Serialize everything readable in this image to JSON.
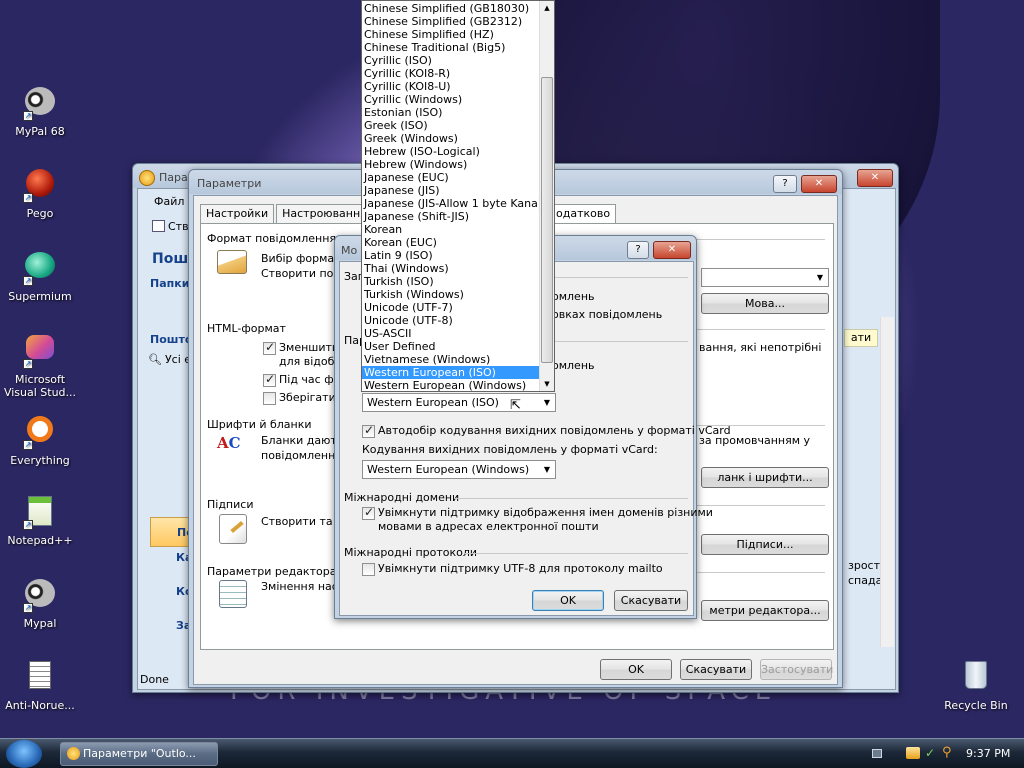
{
  "desktop": {
    "icons": [
      "MyPal 68",
      "Pego",
      "Supermium",
      "Microsoft Visual Stud...",
      "Everything",
      "Notepad++",
      "Mypal",
      "Anti-Norue...",
      "Recycle Bin"
    ],
    "wallpaper_text": "FOR INVESTIGATIVE OF SPACE"
  },
  "outlook": {
    "title": "Параме",
    "menu_file": "Файл",
    "status": "Done",
    "toolbar_item": "Ств",
    "nav": {
      "mail_header": "Пошт",
      "folders_label": "Папки у",
      "mail2": "Пошто",
      "all": "Усі е",
      "side_mail": "По",
      "side_cal": "Ка",
      "side_contacts": "Ко",
      "side_tasks": "За"
    },
    "right": {
      "btn": "ати",
      "text1": "зрост",
      "text2": "спада"
    }
  },
  "params": {
    "title": "Параметри",
    "tabs": [
      "Настройки",
      "Настроювання по",
      "одатково"
    ],
    "sections": {
      "format": "Формат повідомлення",
      "html": "HTML-формат",
      "fonts": "Шрифти й бланки",
      "sign": "Підписи",
      "editor": "Параметри редактора"
    },
    "format_text1": "Вибір формату",
    "format_text2": "Створити повід",
    "lang_btn": "Мова...",
    "html_c1": "Зменшити р",
    "html_c1b": "для відобра",
    "html_c2": "Під час фор",
    "html_c3": "Зберігати см",
    "html_right": "вання, які непотрібні",
    "fonts_text1": "Бланки дають",
    "fonts_text2": "повідомленнях",
    "fonts_right": "за промовчанням у",
    "fonts_btn": "ланк і шрифти...",
    "sign_text": "Створити та зм",
    "sign_btn": "Підписи...",
    "editor_text": "Змінення настро",
    "editor_btn": "метри редактора...",
    "ok": "OK",
    "cancel": "Скасувати",
    "apply": "Застосувати"
  },
  "mova": {
    "title": "Мо",
    "group1": "Заг",
    "group2": "Пар",
    "row1": "омлень",
    "row2": "овках повідомлень",
    "row3": "омлень",
    "encoding_value": "Western European (ISO)",
    "vcard_auto": "Автодобір кодування вихідних повідомлень у форматі vCard",
    "vcard_label": "Кодування вихідних повідомлень у форматі vCard:",
    "vcard_value": "Western European (Windows)",
    "intl_domains": "Міжнародні домени",
    "domains_check": "Увімкнути підтримку відображення імен доменів різними",
    "domains_check2": "мовами в адресах електронної пошти",
    "intl_protocols": "Міжнародні протоколи",
    "utf8_check": "Увімкнути підтримку UTF-8 для протоколу mailto",
    "ok": "OK",
    "cancel": "Скасувати"
  },
  "dropdown": {
    "selected_index": 28,
    "items": [
      "Chinese Simplified (GB18030)",
      "Chinese Simplified (GB2312)",
      "Chinese Simplified (HZ)",
      "Chinese Traditional (Big5)",
      "Cyrillic (ISO)",
      "Cyrillic (KOI8-R)",
      "Cyrillic (KOI8-U)",
      "Cyrillic (Windows)",
      "Estonian (ISO)",
      "Greek (ISO)",
      "Greek (Windows)",
      "Hebrew (ISO-Logical)",
      "Hebrew (Windows)",
      "Japanese (EUC)",
      "Japanese (JIS)",
      "Japanese (JIS-Allow 1 byte Kana)",
      "Japanese (Shift-JIS)",
      "Korean",
      "Korean (EUC)",
      "Latin 9 (ISO)",
      "Thai (Windows)",
      "Turkish (ISO)",
      "Turkish (Windows)",
      "Unicode (UTF-7)",
      "Unicode (UTF-8)",
      "US-ASCII",
      "User Defined",
      "Vietnamese (Windows)",
      "Western European (ISO)",
      "Western European (Windows)"
    ]
  },
  "taskbar": {
    "task": "Параметри \"Outlo...",
    "time": "9:37 PM"
  }
}
